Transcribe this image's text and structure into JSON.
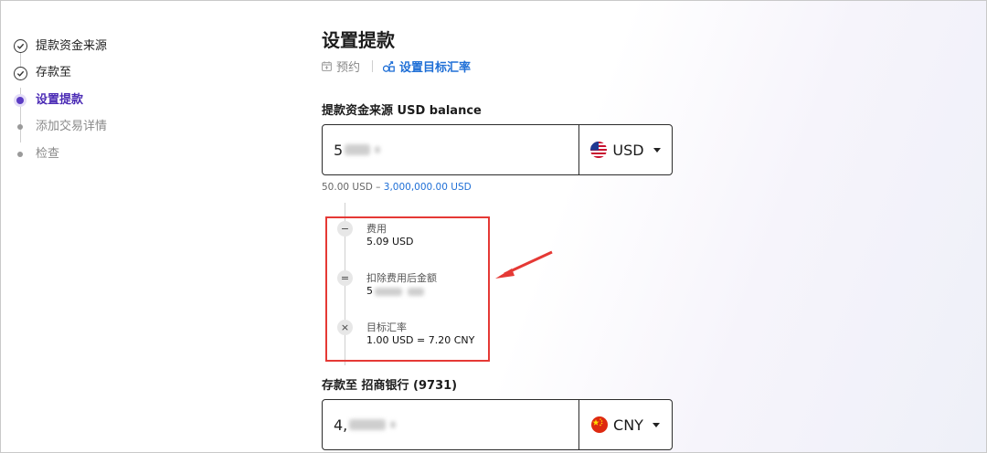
{
  "stepper": {
    "steps": [
      {
        "label": "提款资金来源",
        "state": "done"
      },
      {
        "label": "存款至",
        "state": "done"
      },
      {
        "label": "设置提款",
        "state": "active"
      },
      {
        "label": "添加交易详情",
        "state": "pending"
      },
      {
        "label": "检查",
        "state": "pending"
      }
    ]
  },
  "main": {
    "title": "设置提款",
    "schedule_label": "预约",
    "target_rate_label": "设置目标汇率"
  },
  "source": {
    "label": "提款资金来源 USD balance",
    "amount_visible": "5",
    "currency": "USD",
    "range_min": "50.00 USD",
    "range_sep": " – ",
    "range_max": "3,000,000.00 USD"
  },
  "breakdown": {
    "items": [
      {
        "symbol": "−",
        "icon": "minus-icon",
        "title": "费用",
        "value": "5.09 USD"
      },
      {
        "symbol": "=",
        "icon": "equals-icon",
        "title": "扣除费用后金额",
        "value": "5"
      },
      {
        "symbol": "×",
        "icon": "times-icon",
        "title": "目标汇率",
        "value": "1.00 USD = 7.20 CNY"
      }
    ]
  },
  "destination": {
    "label": "存款至 招商银行 (9731)",
    "amount_visible": "4,",
    "currency": "CNY"
  },
  "colors": {
    "accent": "#4b2bb5",
    "link": "#1f6fd6",
    "highlight": "#e53935"
  }
}
